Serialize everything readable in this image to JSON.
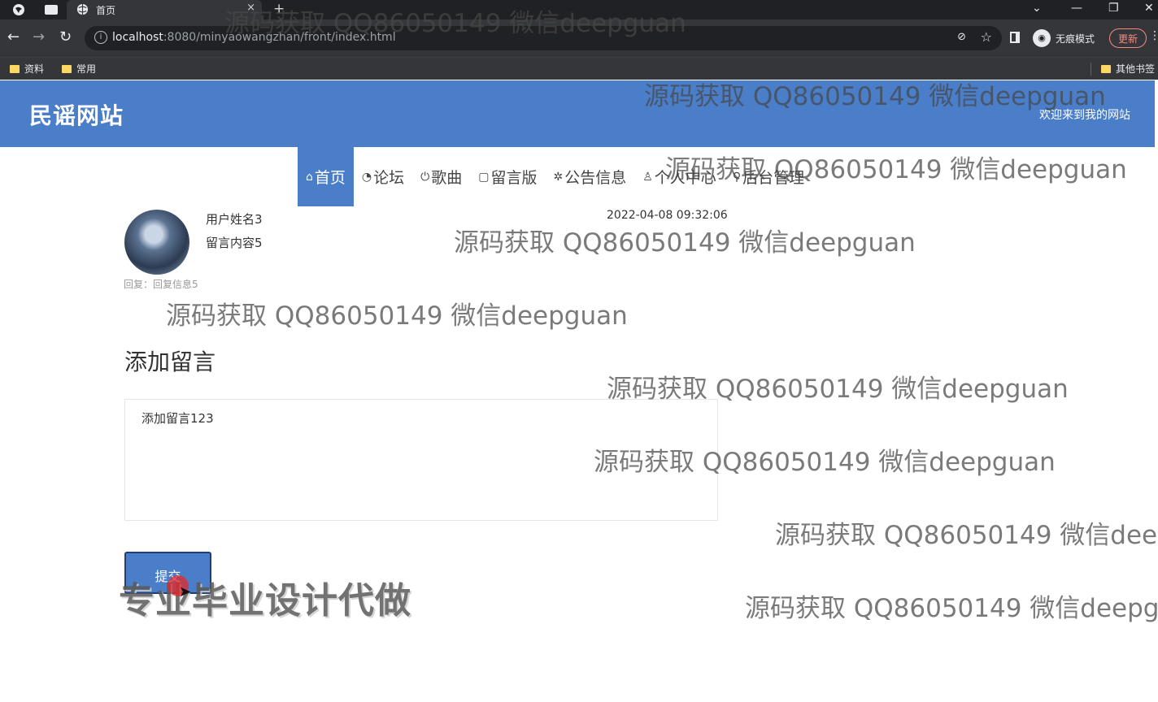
{
  "browser": {
    "tab_title": "首页",
    "url_host": "localhost",
    "url_rest": ":8080/minyaowangzhan/front/index.html",
    "incognito_label": "无痕模式",
    "update_label": "更新",
    "bookmarks": [
      "资料",
      "常用"
    ],
    "other_bookmarks": "其他书签"
  },
  "site": {
    "title": "民谣网站",
    "welcome": "欢迎来到我的网站",
    "nav": [
      {
        "icon": "⌂",
        "label": "首页"
      },
      {
        "icon": "◔",
        "label": "论坛"
      },
      {
        "icon": "⏻",
        "label": "歌曲"
      },
      {
        "icon": "▢",
        "label": "留言版"
      },
      {
        "icon": "✲",
        "label": "公告信息"
      },
      {
        "icon": "♙",
        "label": "个人中心"
      },
      {
        "icon": "⚲",
        "label": "后台管理"
      }
    ]
  },
  "message": {
    "user": "用户姓名3",
    "content": "留言内容5",
    "time": "2022-04-08 09:32:06",
    "reply": "回复：回复信息5"
  },
  "form": {
    "heading": "添加留言",
    "textarea_value": "添加留言123",
    "submit_label": "提交"
  },
  "overlay": {
    "watermark": "源码获取 QQ86050149 微信deepguan",
    "banner": "专业毕业设计代做"
  }
}
